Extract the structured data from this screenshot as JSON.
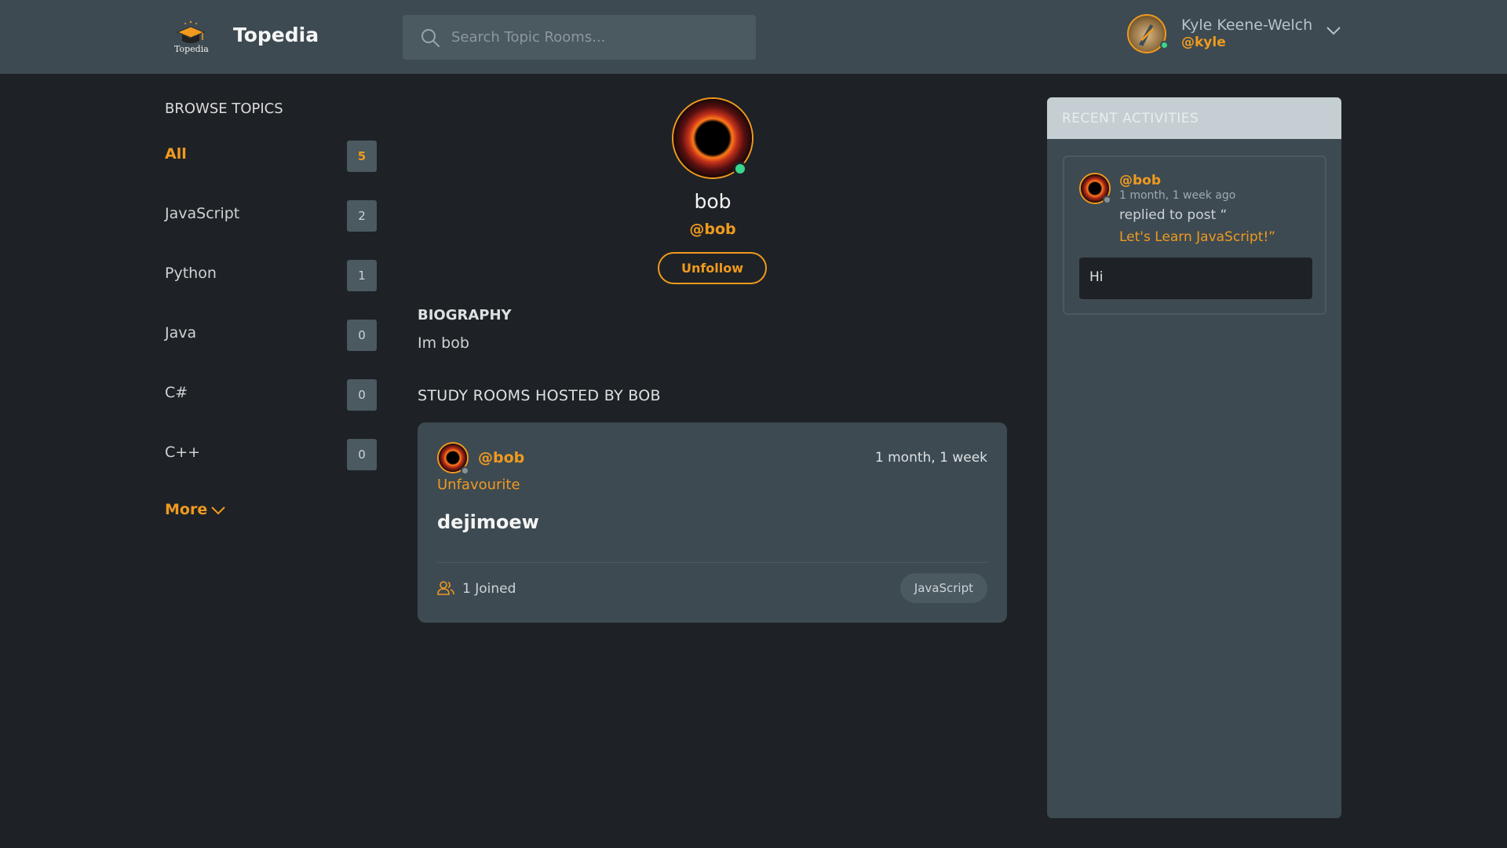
{
  "header": {
    "brand": "Topedia",
    "logo_text": "Topedia",
    "search": {
      "placeholder": "Search Topic Rooms..."
    },
    "user": {
      "name": "Kyle Keene-Welch",
      "handle": "@kyle",
      "status": "online"
    }
  },
  "sidebar": {
    "title": "BROWSE TOPICS",
    "topics": [
      {
        "name": "All",
        "count": "5",
        "active": true
      },
      {
        "name": "JavaScript",
        "count": "2"
      },
      {
        "name": "Python",
        "count": "1"
      },
      {
        "name": "Java",
        "count": "0"
      },
      {
        "name": "C#",
        "count": "0"
      },
      {
        "name": "C++",
        "count": "0"
      }
    ],
    "more_label": "More"
  },
  "profile": {
    "name": "bob",
    "handle": "@bob",
    "status": "online",
    "unfollow_label": "Unfollow",
    "bio_title": "BIOGRAPHY",
    "bio": "Im bob",
    "rooms_title": "STUDY ROOMS HOSTED BY BOB"
  },
  "rooms": [
    {
      "host": "@bob",
      "time": "1 month, 1 week",
      "fav_label": "Unfavourite",
      "title": "dejimoew",
      "joined": "1 Joined",
      "topic": "JavaScript"
    }
  ],
  "activities": {
    "title": "RECENT ACTIVITIES",
    "items": [
      {
        "user": "@bob",
        "time": "1 month, 1 week ago",
        "action": "replied to post “",
        "post": "Let's Learn JavaScript!”",
        "reply": "Hi"
      }
    ]
  },
  "colors": {
    "accent": "#f09a1e",
    "background": "#1e2226",
    "panel": "#3d4a52",
    "online": "#3bd68d"
  }
}
